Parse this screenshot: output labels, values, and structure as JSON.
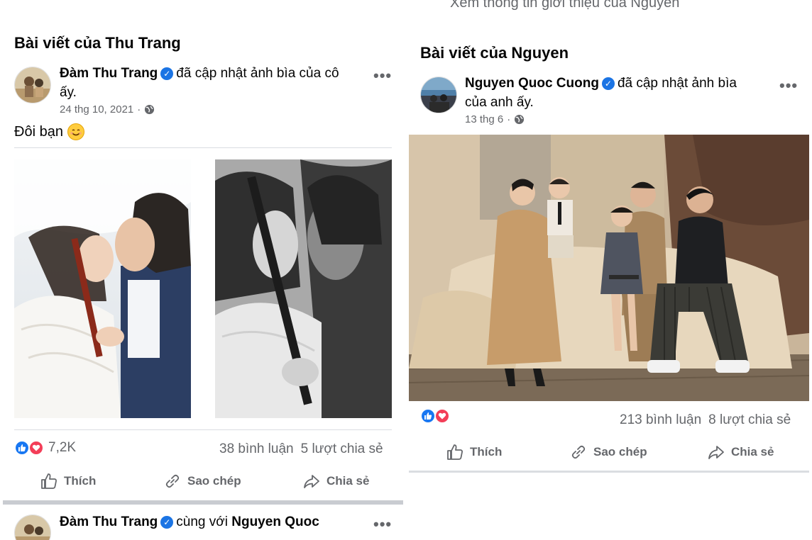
{
  "left": {
    "cut_text": "",
    "section_title": "Bài viết của Thu Trang",
    "post1": {
      "author": "Đàm Thu Trang",
      "action_line1": "đã cập nhật ảnh bìa của cô",
      "action_line2": "ấy.",
      "date": "24 thg 10, 2021",
      "dot": "·",
      "caption": "Đôi bạn",
      "more": "•••",
      "reaction_count": "7,2K",
      "comments": "38 bình luận",
      "shares": "5 lượt chia sẻ",
      "actions": {
        "like": "Thích",
        "copy": "Sao chép",
        "share": "Chia sẻ"
      }
    },
    "post2": {
      "author": "Đàm Thu Trang",
      "with": "cùng với",
      "with_name": "Nguyen Quoc",
      "more": "•••"
    }
  },
  "right": {
    "cut_text": "Xem thông tin giới thiệu của Nguyen",
    "section_title": "Bài viết của Nguyen",
    "post": {
      "author": "Nguyen Quoc Cuong",
      "action_line1": "đã cập nhật ảnh bìa",
      "action_line2": "của anh ấy.",
      "date": "13 thg 6",
      "dot": "·",
      "more": "•••",
      "comments": "213 bình luận",
      "shares": "8 lượt chia sẻ",
      "actions": {
        "like": "Thích",
        "copy": "Sao chép",
        "share": "Chia sẻ"
      }
    }
  },
  "colors": {
    "verified": "#1b74e4",
    "like": "#1877f2",
    "love": "#f33e58",
    "secondary_text": "#65676b"
  },
  "icons": [
    "verified-badge-icon",
    "globe-icon",
    "more-icon",
    "smiley-emoji-icon",
    "like-reaction-icon",
    "love-reaction-icon",
    "thumbs-up-icon",
    "copy-link-icon",
    "share-arrow-icon"
  ]
}
